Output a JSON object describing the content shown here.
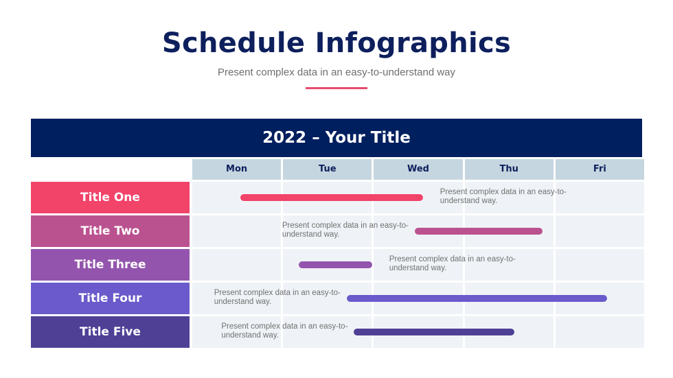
{
  "header": {
    "title": "Schedule Infographics",
    "subtitle": "Present complex data in an easy-to-understand way",
    "accent_color": "#e84a6e"
  },
  "chart_data": {
    "type": "gantt",
    "title": "2022 – Your Title",
    "categories": [
      "Mon",
      "Tue",
      "Wed",
      "Thu",
      "Fri"
    ],
    "x_unit": "day index (0 = start of Mon, 5 = end of Fri)",
    "xlim": [
      0,
      5
    ],
    "rows": [
      {
        "label": "Title One",
        "color": "#f24369",
        "start": 0.53,
        "end": 2.54,
        "note": "Present complex data in an easy-to-understand way.",
        "note_side": "right"
      },
      {
        "label": "Title Two",
        "color": "#bb5290",
        "start": 2.45,
        "end": 3.86,
        "note": "Present complex data in an easy-to-understand way.",
        "note_side": "left"
      },
      {
        "label": "Title Three",
        "color": "#9354ae",
        "start": 1.17,
        "end": 1.98,
        "note": "Present complex data in an easy-to-understand way.",
        "note_side": "right"
      },
      {
        "label": "Title Four",
        "color": "#6a5acb",
        "start": 1.7,
        "end": 4.57,
        "note": "Present complex data in an easy-to-understand way.",
        "note_side": "left"
      },
      {
        "label": "Title Five",
        "color": "#4f4096",
        "start": 1.78,
        "end": 3.55,
        "note": "Present complex data in an easy-to-understand way.",
        "note_side": "left"
      }
    ],
    "grid": true
  },
  "colors": {
    "banner": "#001f5e",
    "day_header": "#c6d6e0",
    "cell": "#eff3f7",
    "title_text": "#0d1f5c"
  }
}
